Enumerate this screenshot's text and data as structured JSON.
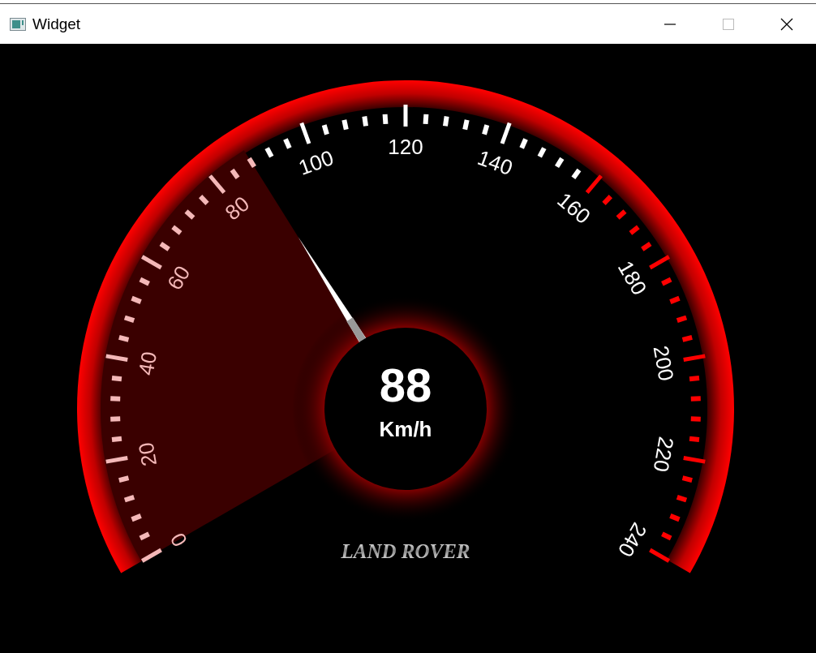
{
  "window": {
    "title": "Widget"
  },
  "gauge": {
    "reading": "88",
    "unit": "Km/h",
    "brand": "LAND ROVER",
    "scale_labels": [
      {
        "text": "0",
        "kind": "normal"
      },
      {
        "text": "20",
        "kind": "normal"
      },
      {
        "text": "40",
        "kind": "normal"
      },
      {
        "text": "60",
        "kind": "normal"
      },
      {
        "text": "80",
        "kind": "normal"
      },
      {
        "text": "100",
        "kind": "normal"
      },
      {
        "text": "120",
        "kind": "normal"
      },
      {
        "text": "140",
        "kind": "normal"
      },
      {
        "text": "160",
        "kind": "redline"
      },
      {
        "text": "180",
        "kind": "redline"
      },
      {
        "text": "200",
        "kind": "redline"
      },
      {
        "text": "220",
        "kind": "redline"
      },
      {
        "text": "240",
        "kind": "redline"
      }
    ]
  }
}
